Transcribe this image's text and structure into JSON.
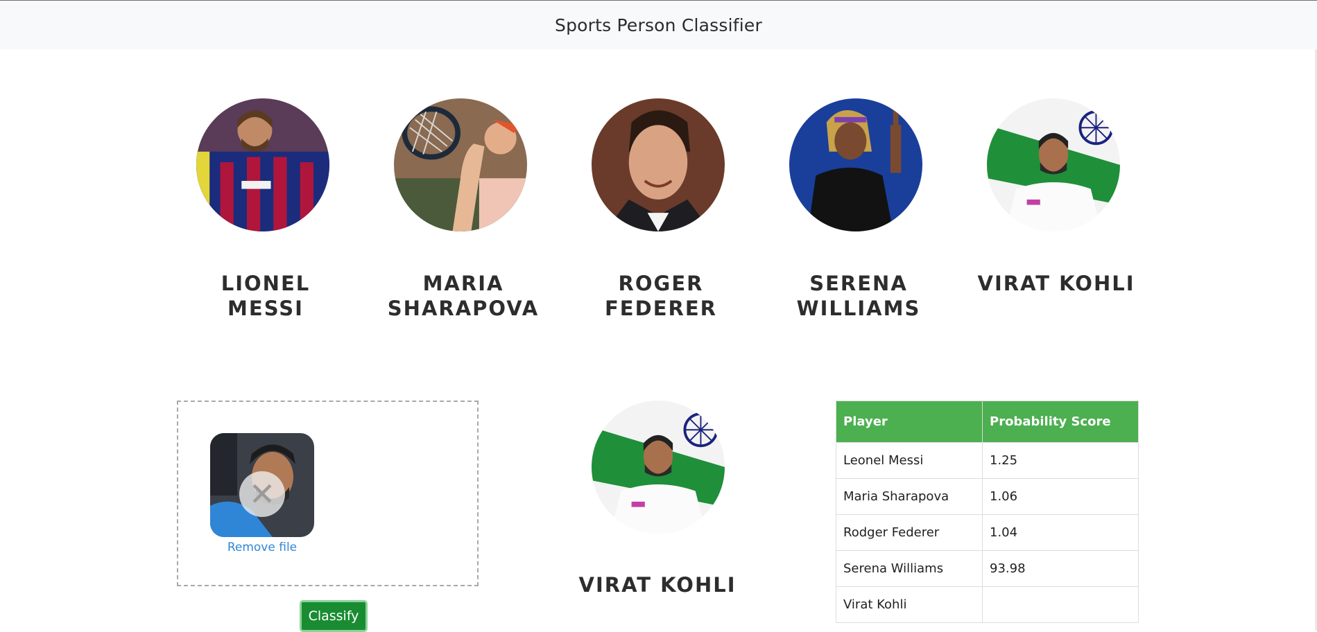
{
  "navbar": {
    "title": "Sports Person Classifier"
  },
  "players": [
    {
      "name": "LIONEL MESSI",
      "photo": "messi-photo"
    },
    {
      "name": "MARIA SHARAPOVA",
      "photo": "sharapova-photo"
    },
    {
      "name": "ROGER FEDERER",
      "photo": "federer-photo"
    },
    {
      "name": "SERENA WILLIAMS",
      "photo": "serena-photo"
    },
    {
      "name": "VIRAT KOHLI",
      "photo": "kohli-photo"
    }
  ],
  "upload": {
    "remove_label": "Remove file",
    "remove_icon": "close-icon"
  },
  "classify_label": "Classify",
  "result": {
    "name": "VIRAT KOHLI"
  },
  "table": {
    "headers": [
      "Player",
      "Probability Score"
    ],
    "rows": [
      {
        "player": "Leonel Messi",
        "score": "1.25"
      },
      {
        "player": "Maria Sharapova",
        "score": "1.06"
      },
      {
        "player": "Rodger Federer",
        "score": "1.04"
      },
      {
        "player": "Serena Williams",
        "score": "93.98"
      },
      {
        "player": "Virat Kohli",
        "score": ""
      }
    ]
  },
  "colors": {
    "table_header": "#4caf50",
    "classify_button": "#198c32",
    "link": "#2f86d6"
  }
}
